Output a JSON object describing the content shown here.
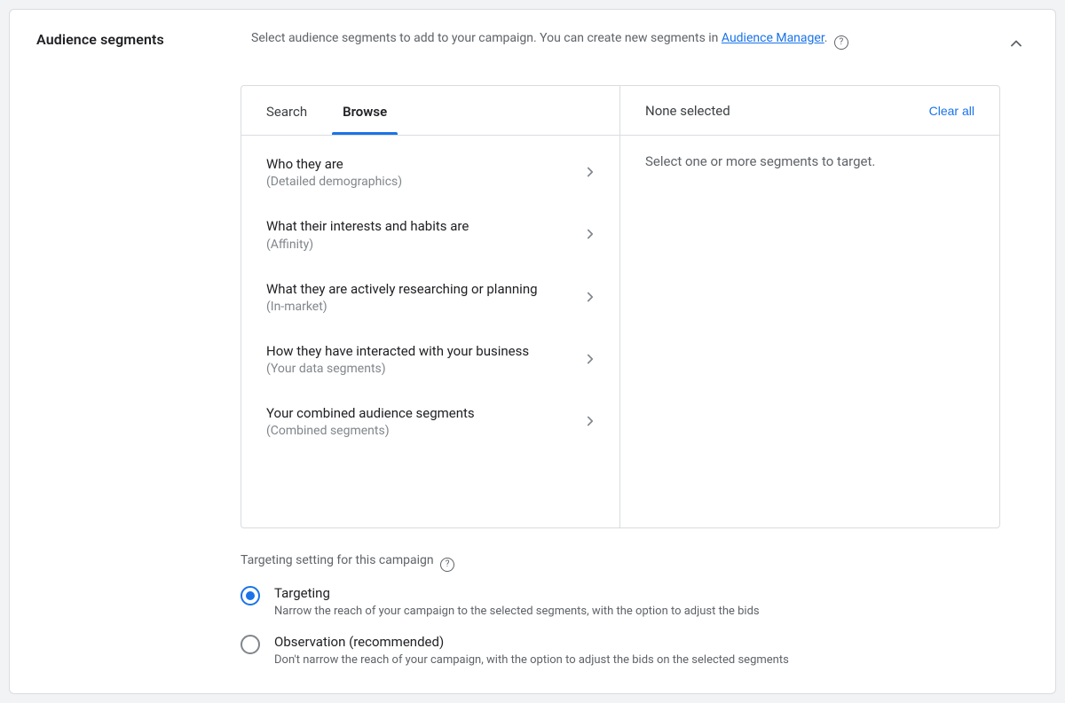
{
  "header": {
    "title": "Audience segments",
    "intro_prefix": "Select audience segments to add to your campaign. You can create new segments in ",
    "intro_link_text": "Audience Manager",
    "intro_suffix": "."
  },
  "tabs": {
    "search": "Search",
    "browse": "Browse"
  },
  "categories": [
    {
      "title": "Who they are",
      "subtitle": "(Detailed demographics)"
    },
    {
      "title": "What their interests and habits are",
      "subtitle": "(Affinity)"
    },
    {
      "title": "What they are actively researching or planning",
      "subtitle": "(In-market)"
    },
    {
      "title": "How they have interacted with your business",
      "subtitle": "(Your data segments)"
    },
    {
      "title": "Your combined audience segments",
      "subtitle": "(Combined segments)"
    }
  ],
  "right": {
    "none_selected": "None selected",
    "clear_all": "Clear all",
    "placeholder": "Select one or more segments to target."
  },
  "targeting": {
    "section_title": "Targeting setting for this campaign",
    "options": [
      {
        "label": "Targeting",
        "desc": "Narrow the reach of your campaign to the selected segments, with the option to adjust the bids",
        "selected": true
      },
      {
        "label": "Observation (recommended)",
        "desc": "Don't narrow the reach of your campaign, with the option to adjust the bids on the selected segments",
        "selected": false
      }
    ]
  }
}
